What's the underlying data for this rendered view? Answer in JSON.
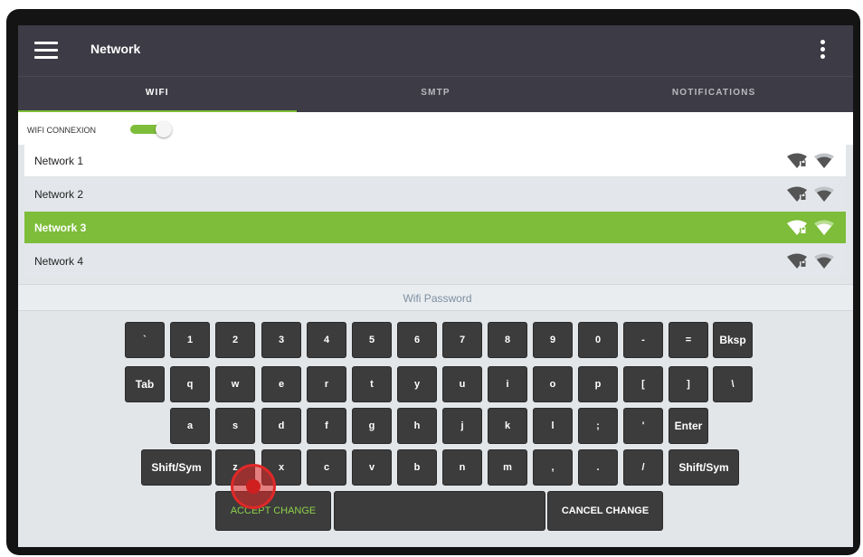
{
  "header": {
    "title": "Network"
  },
  "tabs": [
    {
      "label": "WIFI",
      "active": true
    },
    {
      "label": "SMTP",
      "active": false
    },
    {
      "label": "NOTIFICATIONS",
      "active": false
    }
  ],
  "wifi_toggle": {
    "label": "WIFI CONNEXION",
    "on": true
  },
  "networks": [
    {
      "name": "Network 1",
      "selected": false,
      "icons": [
        "wifi-locked-icon",
        "wifi-signal-icon"
      ]
    },
    {
      "name": "Network 2",
      "selected": false,
      "icons": [
        "wifi-locked-icon",
        "wifi-signal-icon"
      ]
    },
    {
      "name": "Network 3",
      "selected": true,
      "icons": [
        "wifi-locked-icon",
        "wifi-signal-icon"
      ]
    },
    {
      "name": "Network 4",
      "selected": false,
      "icons": [
        "wifi-locked-icon",
        "wifi-signal-icon"
      ]
    }
  ],
  "password": {
    "placeholder": "Wifi Password",
    "value": ""
  },
  "keyboard": {
    "row1": [
      "`",
      "1",
      "2",
      "3",
      "4",
      "5",
      "6",
      "7",
      "8",
      "9",
      "0",
      "-",
      "=",
      "Bksp"
    ],
    "row2": [
      "Tab",
      "q",
      "w",
      "e",
      "r",
      "t",
      "y",
      "u",
      "i",
      "o",
      "p",
      "[",
      "]",
      "\\"
    ],
    "row3": [
      "a",
      "s",
      "d",
      "f",
      "g",
      "h",
      "j",
      "k",
      "l",
      ";",
      "'",
      "Enter"
    ],
    "row4": [
      "Shift/Sym",
      "z",
      "x",
      "c",
      "v",
      "b",
      "n",
      "m",
      ",",
      ".",
      "/",
      "Shift/Sym"
    ],
    "accept_label": "ACCEPT CHANGE",
    "space_label": "",
    "cancel_label": "CANCEL CHANGE"
  },
  "colors": {
    "accent": "#7dbd3a",
    "appbar": "#3d3b45",
    "key": "#3c3c3c",
    "tap_indicator": "#e02828"
  }
}
